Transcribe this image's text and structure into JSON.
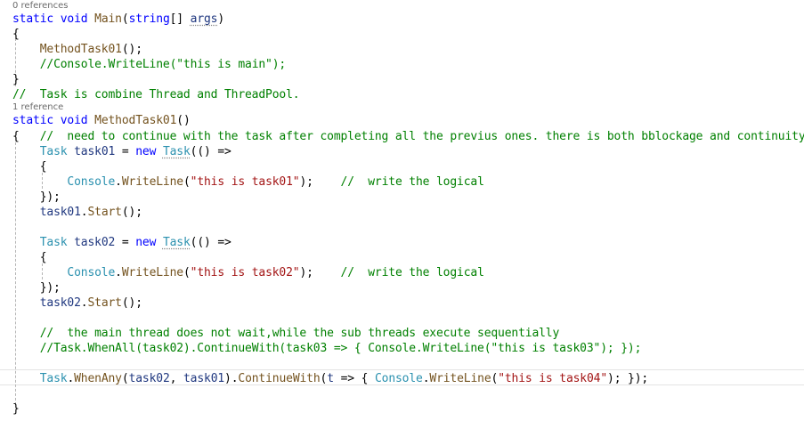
{
  "editor": {
    "codelens": [
      {
        "text": "0 references"
      },
      {
        "text": "1 reference"
      }
    ],
    "lines": [
      {
        "name": "code-line-main-signature",
        "tokens": [
          {
            "t": "static",
            "c": "kw"
          },
          {
            "t": " ",
            "c": "pu"
          },
          {
            "t": "void",
            "c": "kw"
          },
          {
            "t": " ",
            "c": "pu"
          },
          {
            "t": "Main",
            "c": "me"
          },
          {
            "t": "(",
            "c": "pu"
          },
          {
            "t": "string",
            "c": "kw"
          },
          {
            "t": "[] ",
            "c": "pu"
          },
          {
            "t": "args",
            "c": "pm sq"
          },
          {
            "t": ")",
            "c": "pu"
          }
        ]
      },
      {
        "name": "code-line-brace-open",
        "tokens": [
          {
            "t": "{",
            "c": "pu"
          }
        ]
      },
      {
        "name": "code-line-call-method",
        "tokens": [
          {
            "t": "    ",
            "c": "pu"
          },
          {
            "t": "MethodTask01",
            "c": "me"
          },
          {
            "t": "();",
            "c": "pu"
          }
        ]
      },
      {
        "name": "code-line-comment",
        "tokens": [
          {
            "t": "    ",
            "c": "pu"
          },
          {
            "t": "//Console.WriteLine(\"this is main\");",
            "c": "cm"
          }
        ]
      },
      {
        "name": "code-line-brace-close",
        "tokens": [
          {
            "t": "}",
            "c": "pu"
          }
        ]
      },
      {
        "name": "code-line-comment",
        "tokens": [
          {
            "t": "//  Task is combine Thread and ThreadPool.",
            "c": "cm"
          }
        ]
      },
      {
        "name": "code-line-method-signature",
        "tokens": [
          {
            "t": "static",
            "c": "kw"
          },
          {
            "t": " ",
            "c": "pu"
          },
          {
            "t": "void",
            "c": "kw"
          },
          {
            "t": " ",
            "c": "pu"
          },
          {
            "t": "MethodTask01",
            "c": "me"
          },
          {
            "t": "()",
            "c": "pu"
          }
        ]
      },
      {
        "name": "code-line-comment",
        "tokens": [
          {
            "t": "{",
            "c": "pu"
          },
          {
            "t": "   ",
            "c": "pu"
          },
          {
            "t": "//  need to continue with the task after completing all the previus ones. there is both bblockage and continuity",
            "c": "cm"
          }
        ]
      },
      {
        "name": "code-line-task01-decl",
        "tokens": [
          {
            "t": "    ",
            "c": "pu"
          },
          {
            "t": "Task",
            "c": "ty"
          },
          {
            "t": " ",
            "c": "pu"
          },
          {
            "t": "task01",
            "c": "lv"
          },
          {
            "t": " = ",
            "c": "pu"
          },
          {
            "t": "new",
            "c": "kw"
          },
          {
            "t": " ",
            "c": "pu"
          },
          {
            "t": "Task",
            "c": "ty sq"
          },
          {
            "t": "(() =>",
            "c": "pu"
          }
        ]
      },
      {
        "name": "code-line-brace-open",
        "tokens": [
          {
            "t": "    {",
            "c": "pu"
          }
        ]
      },
      {
        "name": "code-line-writeline-task01",
        "tokens": [
          {
            "t": "        ",
            "c": "pu"
          },
          {
            "t": "Console",
            "c": "ty"
          },
          {
            "t": ".",
            "c": "pu"
          },
          {
            "t": "WriteLine",
            "c": "me"
          },
          {
            "t": "(",
            "c": "pu"
          },
          {
            "t": "\"this is task01\"",
            "c": "st"
          },
          {
            "t": ");    ",
            "c": "pu"
          },
          {
            "t": "//  write the logical",
            "c": "cm"
          }
        ]
      },
      {
        "name": "code-line-close-lambda",
        "tokens": [
          {
            "t": "    });",
            "c": "pu"
          }
        ]
      },
      {
        "name": "code-line-task01-start",
        "tokens": [
          {
            "t": "    ",
            "c": "pu"
          },
          {
            "t": "task01",
            "c": "lv"
          },
          {
            "t": ".",
            "c": "pu"
          },
          {
            "t": "Start",
            "c": "me"
          },
          {
            "t": "();",
            "c": "pu"
          }
        ]
      },
      {
        "name": "code-line-blank",
        "tokens": []
      },
      {
        "name": "code-line-task02-decl",
        "tokens": [
          {
            "t": "    ",
            "c": "pu"
          },
          {
            "t": "Task",
            "c": "ty"
          },
          {
            "t": " ",
            "c": "pu"
          },
          {
            "t": "task02",
            "c": "lv"
          },
          {
            "t": " = ",
            "c": "pu"
          },
          {
            "t": "new",
            "c": "kw"
          },
          {
            "t": " ",
            "c": "pu"
          },
          {
            "t": "Task",
            "c": "ty sq"
          },
          {
            "t": "(() =>",
            "c": "pu"
          }
        ]
      },
      {
        "name": "code-line-brace-open",
        "tokens": [
          {
            "t": "    {",
            "c": "pu"
          }
        ]
      },
      {
        "name": "code-line-writeline-task02",
        "tokens": [
          {
            "t": "        ",
            "c": "pu"
          },
          {
            "t": "Console",
            "c": "ty"
          },
          {
            "t": ".",
            "c": "pu"
          },
          {
            "t": "WriteLine",
            "c": "me"
          },
          {
            "t": "(",
            "c": "pu"
          },
          {
            "t": "\"this is task02\"",
            "c": "st"
          },
          {
            "t": ");    ",
            "c": "pu"
          },
          {
            "t": "//  write the logical",
            "c": "cm"
          }
        ]
      },
      {
        "name": "code-line-close-lambda",
        "tokens": [
          {
            "t": "    });",
            "c": "pu"
          }
        ]
      },
      {
        "name": "code-line-task02-start",
        "tokens": [
          {
            "t": "    ",
            "c": "pu"
          },
          {
            "t": "task02",
            "c": "lv"
          },
          {
            "t": ".",
            "c": "pu"
          },
          {
            "t": "Start",
            "c": "me"
          },
          {
            "t": "();",
            "c": "pu"
          }
        ]
      },
      {
        "name": "code-line-blank",
        "tokens": []
      },
      {
        "name": "code-line-comment",
        "tokens": [
          {
            "t": "    ",
            "c": "pu"
          },
          {
            "t": "//  the main thread does not wait,while the sub threads execute sequentially",
            "c": "cm"
          }
        ]
      },
      {
        "name": "code-line-comment",
        "tokens": [
          {
            "t": "    ",
            "c": "pu"
          },
          {
            "t": "//Task.WhenAll(task02).ContinueWith(task03 => { Console.WriteLine(\"this is task03\"); });",
            "c": "cm"
          }
        ]
      },
      {
        "name": "code-line-blank",
        "tokens": []
      },
      {
        "name": "code-line-whenany",
        "tokens": [
          {
            "t": "    ",
            "c": "pu"
          },
          {
            "t": "Task",
            "c": "ty"
          },
          {
            "t": ".",
            "c": "pu"
          },
          {
            "t": "WhenAny",
            "c": "me"
          },
          {
            "t": "(",
            "c": "pu"
          },
          {
            "t": "task02",
            "c": "lv"
          },
          {
            "t": ", ",
            "c": "pu"
          },
          {
            "t": "task01",
            "c": "lv"
          },
          {
            "t": ").",
            "c": "pu"
          },
          {
            "t": "ContinueWith",
            "c": "me"
          },
          {
            "t": "(",
            "c": "pu"
          },
          {
            "t": "t",
            "c": "pm"
          },
          {
            "t": " => { ",
            "c": "pu"
          },
          {
            "t": "Console",
            "c": "ty"
          },
          {
            "t": ".",
            "c": "pu"
          },
          {
            "t": "WriteLine",
            "c": "me"
          },
          {
            "t": "(",
            "c": "pu"
          },
          {
            "t": "\"this is task04\"",
            "c": "st"
          },
          {
            "t": "); });",
            "c": "pu"
          }
        ]
      },
      {
        "name": "code-line-blank",
        "tokens": []
      },
      {
        "name": "code-line-brace-close",
        "tokens": [
          {
            "t": "}",
            "c": "pu"
          }
        ]
      }
    ]
  }
}
